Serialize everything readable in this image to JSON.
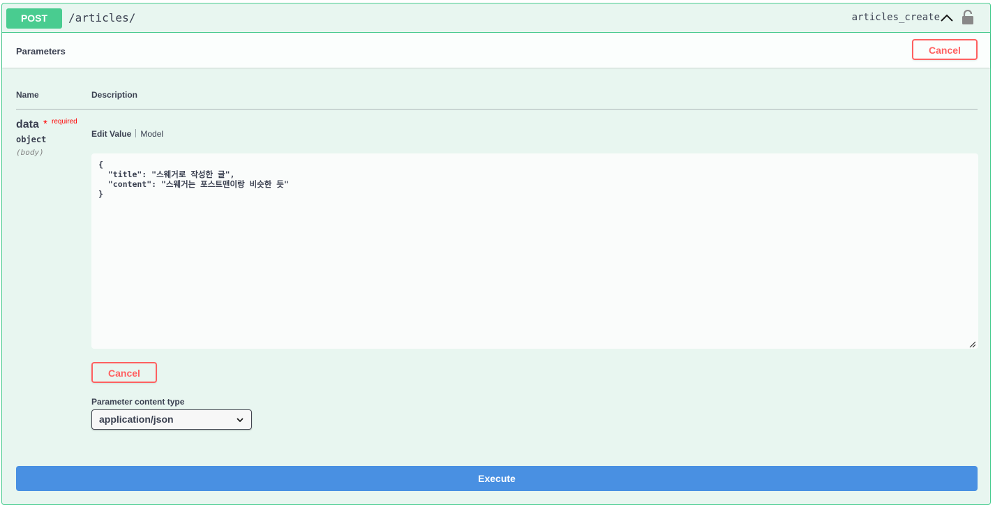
{
  "operation": {
    "method": "POST",
    "path": "/articles/",
    "operation_id": "articles_create",
    "icons": {
      "collapse": "chevron-up-icon",
      "auth": "lock-icon"
    }
  },
  "parameters": {
    "title": "Parameters",
    "cancel_label": "Cancel",
    "columns": {
      "name": "Name",
      "description": "Description"
    },
    "param": {
      "name": "data",
      "required_star": "*",
      "required_label": "required",
      "type": "object",
      "in": "(body)"
    },
    "tabs": {
      "edit_value": "Edit Value",
      "model": "Model"
    },
    "body_value": "{\n  \"title\": \"스웨거로 작성한 글\",\n  \"content\": \"스웨거는 포스트맨이랑 비슷한 듯\"\n}",
    "inline_cancel_label": "Cancel",
    "content_type_label": "Parameter content type",
    "content_type_value": "application/json"
  },
  "execute_label": "Execute",
  "colors": {
    "post_green": "#49cc90",
    "cancel_red": "#ff6060",
    "execute_blue": "#4990e2",
    "block_bg": "#e8f6f0"
  }
}
